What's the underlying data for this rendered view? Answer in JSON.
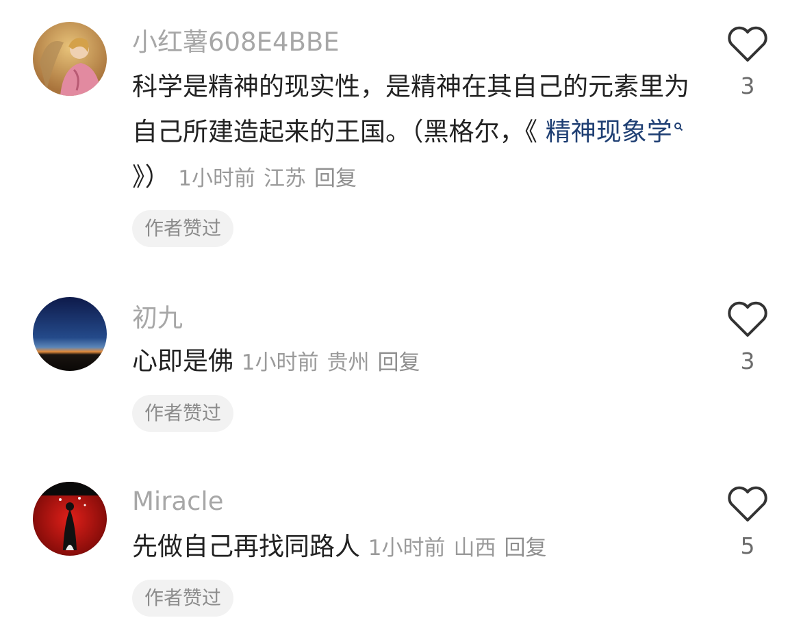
{
  "comments": [
    {
      "username": "小红薯608E4BBE",
      "text_before": "科学是精神的现实性，是精神在其自己的元素里为自己所建造起来的王国。（黑格尔，《 ",
      "link_text": "精神现象学",
      "text_after": " 》）",
      "time": "1小时前",
      "location": "江苏",
      "reply": "回复",
      "badge": "作者赞过",
      "like_count": "3",
      "avatar_icon": "angel-painting-avatar"
    },
    {
      "username": "初九",
      "text": "心即是佛",
      "time": "1小时前",
      "location": "贵州",
      "reply": "回复",
      "badge": "作者赞过",
      "like_count": "3",
      "avatar_icon": "dusk-horizon-avatar"
    },
    {
      "username": "Miracle",
      "text": "先做自己再找同路人",
      "time": "1小时前",
      "location": "山西",
      "reply": "回复",
      "badge": "作者赞过",
      "like_count": "5",
      "avatar_icon": "red-figure-avatar"
    }
  ]
}
